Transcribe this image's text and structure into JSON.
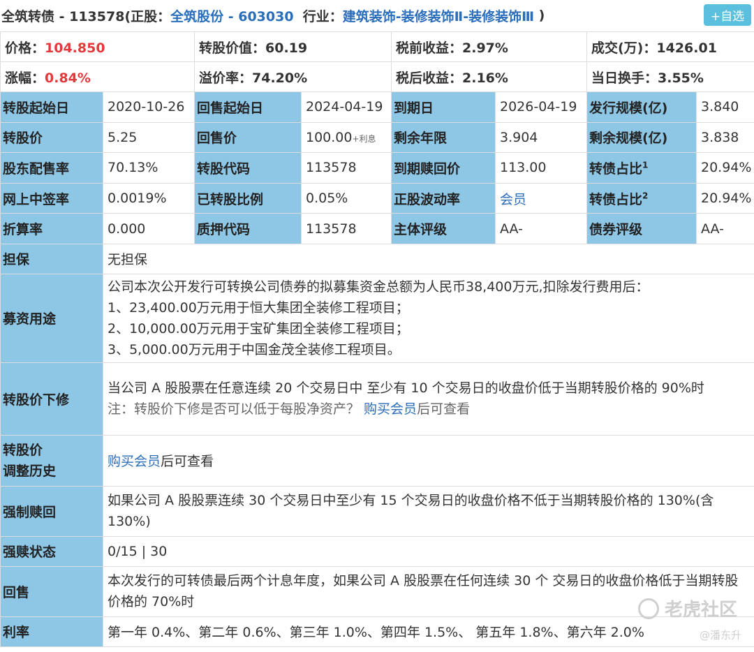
{
  "header": {
    "bond_name": "全筑转债 - 113578",
    "stock_prefix": " (正股：",
    "stock_name": "全筑股份 - 603030",
    "industry_prefix": "  行业：",
    "industry": "建筑装饰-装修装饰Ⅱ-装修装饰Ⅲ",
    "close_paren": " )",
    "add_button": "+自选"
  },
  "summary": [
    [
      {
        "label": "价格：",
        "value": "104.850",
        "red": true
      },
      {
        "label": "转股价值：",
        "value": "60.19"
      },
      {
        "label": "税前收益：",
        "value": "2.97%"
      },
      {
        "label": "成交(万)：",
        "value": "1426.01"
      }
    ],
    [
      {
        "label": "涨幅：",
        "value": "0.84%",
        "red": true
      },
      {
        "label": "溢价率：",
        "value": "74.20%"
      },
      {
        "label": "税后收益：",
        "value": "2.16%"
      },
      {
        "label": "当日换手：",
        "value": "3.55%"
      }
    ]
  ],
  "grid": [
    [
      {
        "l": "转股起始日",
        "v": "2020-10-26"
      },
      {
        "l": "回售起始日",
        "v": "2024-04-19"
      },
      {
        "l": "到期日",
        "v": "2026-04-19"
      },
      {
        "l": "发行规模(亿)",
        "v": "3.840"
      }
    ],
    [
      {
        "l": "转股价",
        "v": "5.25"
      },
      {
        "l": "回售价",
        "v": "100.00",
        "note": "+利息"
      },
      {
        "l": "剩余年限",
        "v": "3.904"
      },
      {
        "l": "剩余规模(亿)",
        "v": "3.838"
      }
    ],
    [
      {
        "l": "股东配售率",
        "v": "70.13%"
      },
      {
        "l": "转股代码",
        "v": "113578"
      },
      {
        "l": "到期赎回价",
        "v": "113.00"
      },
      {
        "l": "转债占比",
        "sup": "1",
        "v": "20.94%"
      }
    ],
    [
      {
        "l": "网上中签率",
        "v": "0.0019%"
      },
      {
        "l": "已转股比例",
        "v": "0.05%"
      },
      {
        "l": "正股波动率",
        "v": "会员",
        "link": true
      },
      {
        "l": "转债占比",
        "sup": "2",
        "v": "20.94%"
      }
    ],
    [
      {
        "l": "折算率",
        "v": "0.000"
      },
      {
        "l": "质押代码",
        "v": "113578"
      },
      {
        "l": "主体评级",
        "v": "AA-"
      },
      {
        "l": "债券评级",
        "v": "AA-"
      }
    ]
  ],
  "details": {
    "guarantee": {
      "label": "担保",
      "text": "无担保"
    },
    "funds": {
      "label": "募资用途",
      "lines": [
        "公司本次公开发行可转换公司债券的拟募集资金总额为人民币38,400万元,扣除发行费用后：",
        "1、23,400.00万元用于恒大集团全装修工程项目；",
        "2、10,000.00万元用于宝矿集团全装修工程项目；",
        "3、5,000.00万元用于中国金茂全装修工程项目。"
      ]
    },
    "down_revision": {
      "label": "转股价下修",
      "text": "当公司 A 股股票在任意连续 20 个交易日中 至少有 10 个交易日的收盘价低于当期转股价格的 90%时",
      "note_prefix": "注：转股价下修是否可以低于每股净资产？ ",
      "note_link": "购买会员",
      "note_suffix": "后可查看"
    },
    "adjust_history": {
      "label_line1": "转股价",
      "label_line2": "调整历史",
      "link": "购买会员",
      "suffix": "后可查看"
    },
    "forced_redeem": {
      "label": "强制赎回",
      "text": "如果公司 A 股股票连续 30 个交易日中至少有 15 个交易日的收盘价格不低于当期转股价格的 130%(含 130%)"
    },
    "redeem_status": {
      "label": "强赎状态",
      "text": "0/15 | 30"
    },
    "putback": {
      "label": "回售",
      "text": "本次发行的可转债最后两个计息年度，如果公司 A 股股票在任何连续 30 个 交易日的收盘价格低于当期转股价格的 70%时"
    },
    "interest": {
      "label": "利率",
      "text": "第一年 0.4%、第二年 0.6%、第三年 1.0%、第四年 1.5%、 第五年 1.8%、第六年 2.0%"
    }
  },
  "watermark": {
    "brand": "老虎社区",
    "author": "@潘东升"
  }
}
